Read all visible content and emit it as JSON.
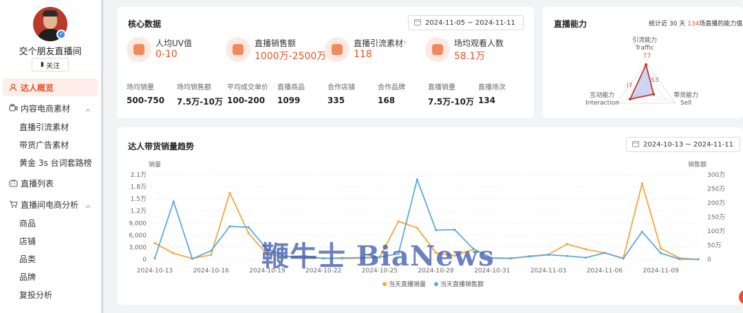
{
  "profile": {
    "name": "交个朋友直播间",
    "follow_label": "关注"
  },
  "sidebar": {
    "overview": "达人概览",
    "content": "内容电商素材",
    "content_sub": [
      "直播引流素材",
      "带货广告素材",
      "黄金 3s 台词套路榜"
    ],
    "live_list": "直播列表",
    "analysis": "直播间电商分析",
    "analysis_sub": [
      "商品",
      "店铺",
      "品类",
      "品牌",
      "复投分析"
    ]
  },
  "core": {
    "title": "核心数据",
    "date_range": "2024-11-05 ~ 2024-11-11",
    "metrics": [
      {
        "label": "人均UV值",
        "value": "0-10"
      },
      {
        "label": "直播销售额",
        "value": "1000万-2500万"
      },
      {
        "label": "直播引流素材",
        "value": "118"
      },
      {
        "label": "场均观看人数",
        "value": "58.1万"
      }
    ],
    "stats": [
      {
        "label": "场均销量",
        "value": "500-750"
      },
      {
        "label": "场均销售额",
        "value": "7.5万-10万"
      },
      {
        "label": "平均成交单价",
        "value": "100-200"
      },
      {
        "label": "直播商品",
        "value": "1099"
      },
      {
        "label": "合作店铺",
        "value": "335"
      },
      {
        "label": "合作品牌",
        "value": "168"
      },
      {
        "label": "直播销量",
        "value": "7.5万-10万"
      },
      {
        "label": "直播场次",
        "value": "134"
      }
    ]
  },
  "ability": {
    "title": "直播能力",
    "note_prefix": "统计近 30 天",
    "note_count": "134",
    "note_suffix": "场直播的能力值",
    "traffic_cn": "引流能力",
    "traffic_en": "Traffic",
    "traffic_grade": "T7",
    "interaction_cn": "互动能力",
    "interaction_en": "Interaction",
    "interaction_grade": "I7",
    "sell_cn": "带货能力",
    "sell_en": "Sell",
    "sell_grade": "S3"
  },
  "trend": {
    "title": "达人带货销量趋势",
    "date_range": "2024-10-13 ~ 2024-11-11",
    "left_axis_label": "销量",
    "right_axis_label": "销售额",
    "legend_sales": "当天直播销量",
    "legend_revenue": "当天直播销售额"
  },
  "watermark": "鞭牛士 BiaNews",
  "colors": {
    "accent": "#e4542a",
    "sales": "#f5a540",
    "revenue": "#5aa9e6"
  },
  "chart_data": {
    "type": "line",
    "x": [
      "2024-10-13",
      "2024-10-14",
      "2024-10-15",
      "2024-10-16",
      "2024-10-17",
      "2024-10-18",
      "2024-10-19",
      "2024-10-20",
      "2024-10-21",
      "2024-10-22",
      "2024-10-23",
      "2024-10-24",
      "2024-10-25",
      "2024-10-26",
      "2024-10-27",
      "2024-10-28",
      "2024-10-29",
      "2024-10-30",
      "2024-10-31",
      "2024-11-01",
      "2024-11-02",
      "2024-11-03",
      "2024-11-04",
      "2024-11-05",
      "2024-11-06",
      "2024-11-07",
      "2024-11-08",
      "2024-11-09",
      "2024-11-10",
      "2024-11-11"
    ],
    "x_ticks": [
      "2024-10-13",
      "2024-10-16",
      "2024-10-19",
      "2024-10-22",
      "2024-10-25",
      "2024-10-28",
      "2024-10-31",
      "2024-11-03",
      "2024-11-06",
      "2024-11-09"
    ],
    "left_ticks": [
      "0",
      "3,000",
      "6,000",
      "9,000",
      "1.2万",
      "1.5万",
      "1.8万",
      "2.1万"
    ],
    "right_ticks": [
      "0",
      "50万",
      "100万",
      "150万",
      "200万",
      "250万",
      "300万"
    ],
    "ylim_left": [
      0,
      21000
    ],
    "ylim_right": [
      0,
      3000000
    ],
    "series": [
      {
        "name": "当天直播销量",
        "axis": "left",
        "color": "#f5a540",
        "values": [
          4000,
          1500,
          200,
          1100,
          16500,
          6500,
          1200,
          700,
          400,
          300,
          200,
          300,
          500,
          9400,
          7800,
          1600,
          900,
          2500,
          300,
          200,
          800,
          1200,
          3800,
          2500,
          1600,
          300,
          18800,
          2700,
          300,
          0
        ]
      },
      {
        "name": "当天直播销售额",
        "axis": "right",
        "color": "#5aa9e6",
        "values": [
          40000,
          2050000,
          20000,
          300000,
          1170000,
          1140000,
          350000,
          100000,
          120000,
          30000,
          50000,
          60000,
          80000,
          200000,
          2830000,
          1040000,
          1050000,
          370000,
          50000,
          40000,
          100000,
          160000,
          120000,
          60000,
          230000,
          30000,
          980000,
          220000,
          10000,
          0
        ]
      }
    ]
  }
}
